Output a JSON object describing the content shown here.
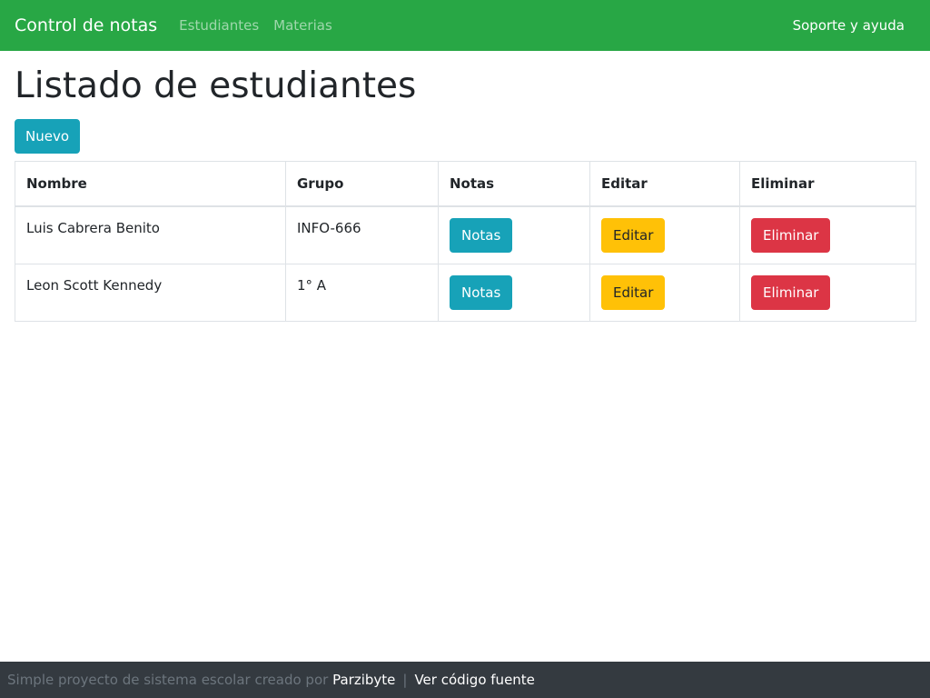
{
  "navbar": {
    "brand": "Control de notas",
    "links": [
      "Estudiantes",
      "Materias"
    ],
    "right_link": "Soporte y ayuda",
    "bg_color": "#28a745"
  },
  "main": {
    "title": "Listado de estudiantes",
    "new_button": "Nuevo",
    "table": {
      "headers": [
        "Nombre",
        "Grupo",
        "Notas",
        "Editar",
        "Eliminar"
      ],
      "rows": [
        {
          "nombre": "Luis Cabrera Benito",
          "grupo": "INFO-666",
          "notas": "Notas",
          "editar": "Editar",
          "eliminar": "Eliminar"
        },
        {
          "nombre": "Leon Scott Kennedy",
          "grupo": "1° A",
          "notas": "Notas",
          "editar": "Editar",
          "eliminar": "Eliminar"
        }
      ]
    }
  },
  "footer": {
    "text": "Simple proyecto de sistema escolar creado por",
    "author": "Parzibyte",
    "separator": "|",
    "source_link": "Ver código fuente"
  }
}
